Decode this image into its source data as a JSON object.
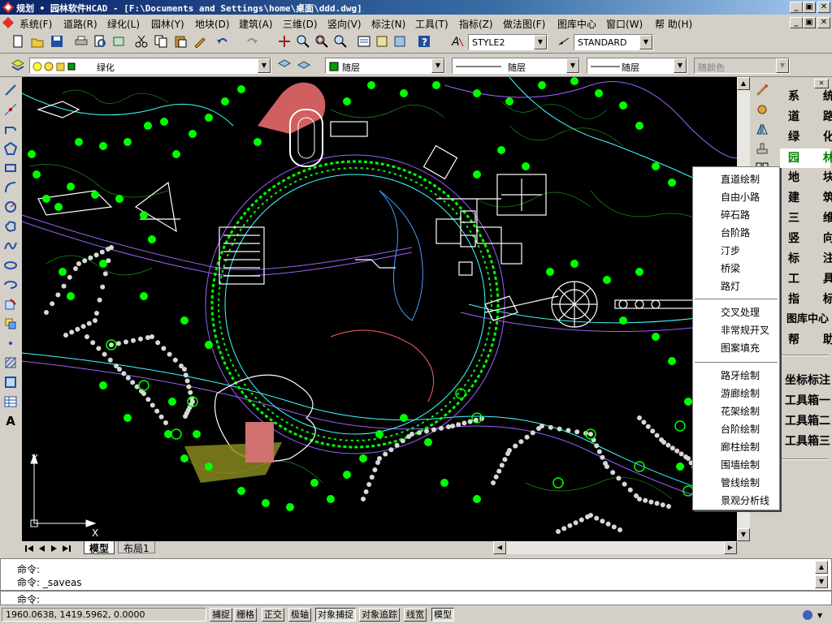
{
  "window": {
    "title": "规划 • 园林软件HCAD  - [F:\\Documents and Settings\\home\\桌面\\ddd.dwg]",
    "min": "_",
    "restore": "▣",
    "close": "✕"
  },
  "menu": [
    "系统(F)",
    "道路(R)",
    "绿化(L)",
    "园林(Y)",
    "地块(D)",
    "建筑(A)",
    "三维(D)",
    "竖向(V)",
    "标注(N)",
    "工具(T)",
    "指标(Z)",
    "做法图(F)",
    "图库中心",
    "窗口(W)",
    "帮 助(H)"
  ],
  "toolbar1": {
    "textstyle": "STYLE2",
    "dimstyle": "STANDARD"
  },
  "toolbar2": {
    "layer": "绿化",
    "color": "随层",
    "linetype": "随层",
    "lineweight": "随层",
    "plotstyle": "随颜色"
  },
  "tabs": [
    "模型",
    "布局1"
  ],
  "commands": [
    "命令:",
    "命令: _saveas"
  ],
  "prompt": "命令:",
  "coords": "1960.0638,  1419.5962,  0.0000",
  "status": [
    "捕捉",
    "栅格",
    "正交",
    "极轴",
    "对象捕捉",
    "对象追踪",
    "线宽",
    "模型"
  ],
  "status_on": [
    "对象捕捉",
    "模型"
  ],
  "rightpanel": {
    "items": [
      "系  统",
      "道  路",
      "绿  化",
      "园  林",
      "地  块",
      "建  筑",
      "三  维",
      "竖  向",
      "标  注",
      "工  具",
      "指  标"
    ],
    "selected": "园  林",
    "lib": "图库中心",
    "help": "帮  助",
    "extra": [
      "坐标标注",
      "工具箱一",
      "工具箱二",
      "工具箱三"
    ]
  },
  "popup": {
    "group1": [
      "直道绘制",
      "自由小路",
      "碎石路",
      "台阶路",
      "汀步",
      "桥梁",
      "路灯"
    ],
    "group2": [
      "交叉处理",
      "非常规开叉",
      "图案填充"
    ],
    "group3": [
      "路牙绘制",
      "游廊绘制",
      "花架绘制",
      "台阶绘制",
      "廊柱绘制",
      "围墙绘制",
      "管线绘制",
      "景观分析线"
    ]
  },
  "ucs": {
    "x": "X",
    "y": "Y"
  }
}
